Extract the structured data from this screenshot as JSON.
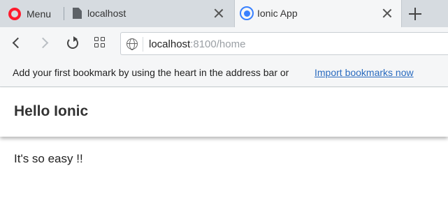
{
  "browser": {
    "menu_label": "Menu",
    "tabs": [
      {
        "title": "localhost",
        "icon": "document-icon",
        "active": false
      },
      {
        "title": "Ionic App",
        "icon": "ionic-logo-icon",
        "active": true
      }
    ],
    "address": {
      "host": "localhost",
      "rest": ":8100/home"
    },
    "bookmarks_bar": {
      "message": "Add your first bookmark by using the heart in the address bar or",
      "link": "Import bookmarks now"
    },
    "colors": {
      "opera_red": "#ff1b2d",
      "ionic_blue": "#3880ff",
      "link_blue": "#2a6bbf"
    }
  },
  "app": {
    "header_title": "Hello Ionic",
    "content_text": "It's so easy !!"
  }
}
